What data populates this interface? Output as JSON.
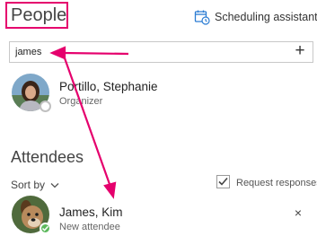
{
  "header": {
    "title": "People",
    "scheduling_label": "Scheduling assistant",
    "scheduling_icon": "calendar-clock-icon"
  },
  "search": {
    "value": "james",
    "add_icon": "+"
  },
  "organizer": {
    "name": "Portillo, Stephanie",
    "role": "Organizer",
    "presence": "offline"
  },
  "attendees": {
    "title": "Attendees",
    "sort_label": "Sort by",
    "request_label": "Request responses",
    "request_checked": true,
    "items": [
      {
        "name": "James, Kim",
        "role": "New attendee",
        "presence": "available",
        "remove_icon": "×"
      }
    ]
  },
  "annotations": {
    "highlight_color": "#e5006d",
    "arrow_color": "#e5006d"
  }
}
